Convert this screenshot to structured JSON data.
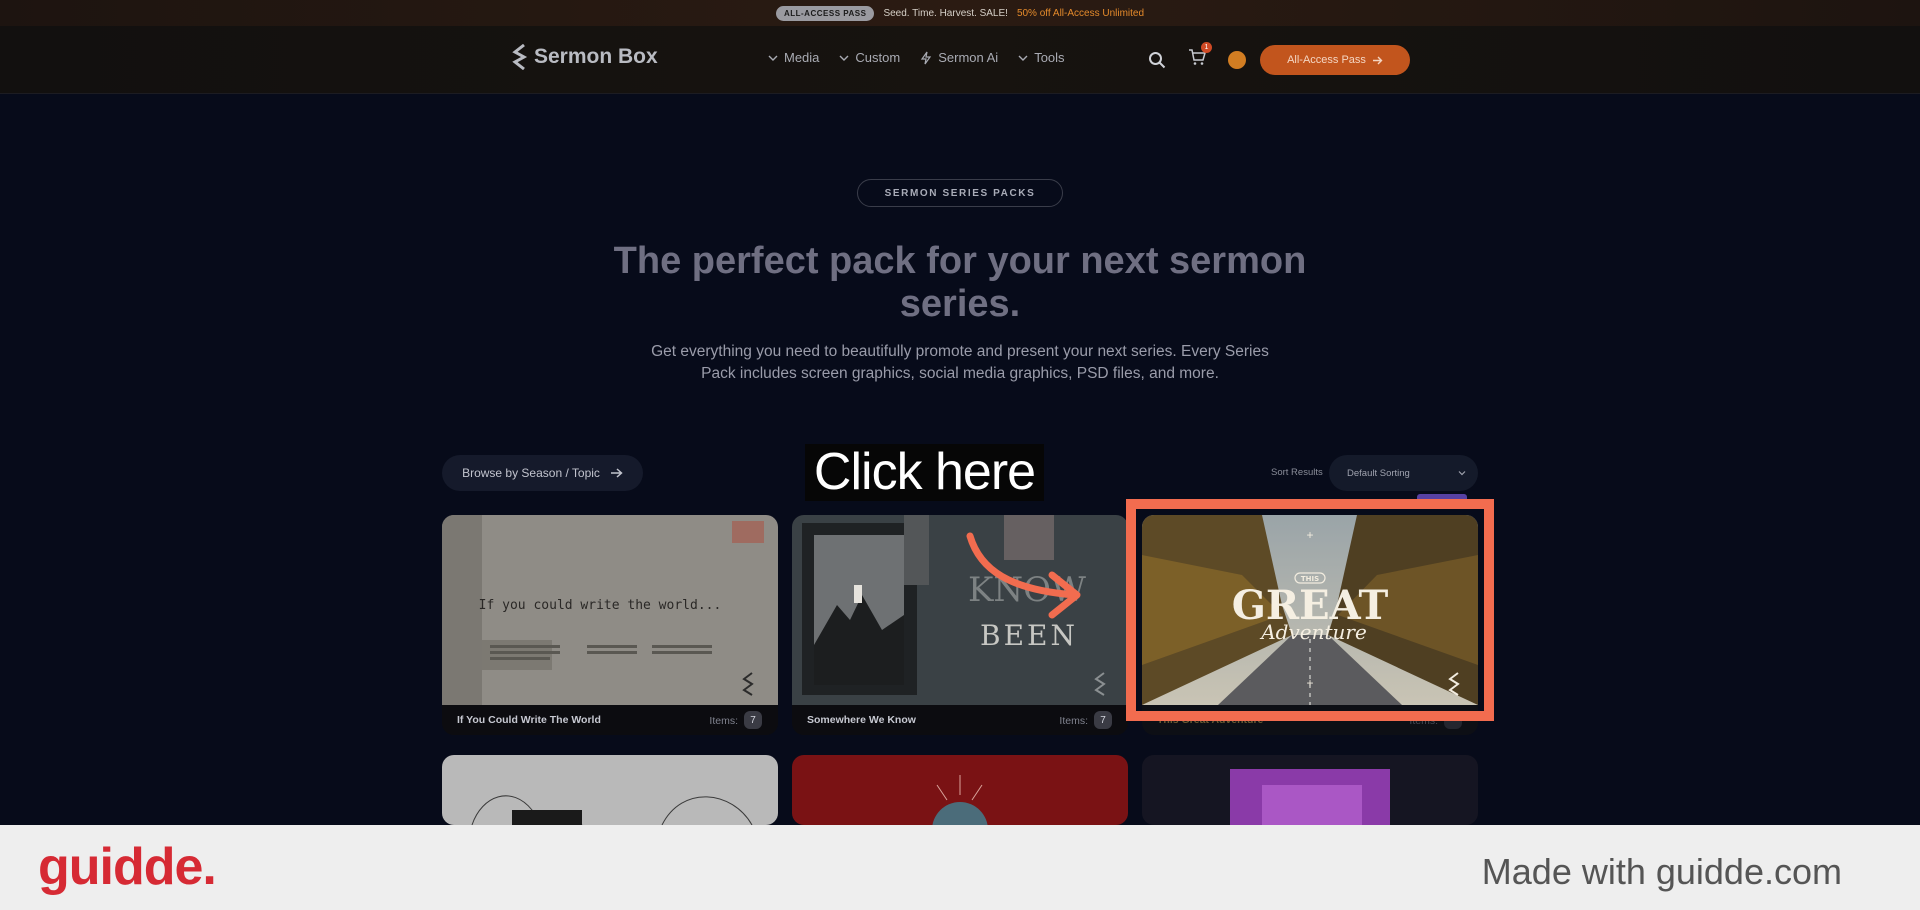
{
  "promo": {
    "pill": "ALL-ACCESS PASS",
    "message": "Seed. Time. Harvest. SALE!",
    "highlight": "50% off All-Access Unlimited"
  },
  "nav": {
    "logo": "Sermon Box",
    "menu": [
      {
        "label": "Media",
        "icon": "chevron-down-icon"
      },
      {
        "label": "Custom",
        "icon": "chevron-down-icon"
      },
      {
        "label": "Sermon Ai",
        "icon": "bolt-icon"
      },
      {
        "label": "Tools",
        "icon": "chevron-down-icon"
      }
    ],
    "cart_count": "1",
    "cta": "All-Access Pass"
  },
  "hero": {
    "badge": "SERMON SERIES PACKS",
    "headline": "The perfect pack for your next sermon series.",
    "subtitle": "Get everything you need to beautifully promote and present your next series. Every Series Pack includes screen graphics, social media graphics, PSD files, and more."
  },
  "controls": {
    "browse": "Browse by Season / Topic",
    "sort_label": "Sort Results",
    "sort_value": "Default Sorting"
  },
  "cards": [
    {
      "title": "If You Could Write The World",
      "items_label": "Items:",
      "count": "7",
      "thumb_text": "If you could write the world..."
    },
    {
      "title": "Somewhere We Know",
      "items_label": "Items:",
      "count": "7",
      "thumb_text_1": "KNOW",
      "thumb_text_2": "BEEN"
    },
    {
      "title": "This Great Adventure",
      "items_label": "Items:",
      "count": "",
      "thumb_text_1": "THIS",
      "thumb_text_2": "GREAT",
      "thumb_text_3": "Adventure"
    }
  ],
  "overlay": {
    "click_label": "Click here",
    "footer_brand": "guidde.",
    "footer_made": "Made with guidde.com"
  },
  "colors": {
    "accent": "#c2551d",
    "highlight": "#f26c4f",
    "background": "#070b1a"
  }
}
